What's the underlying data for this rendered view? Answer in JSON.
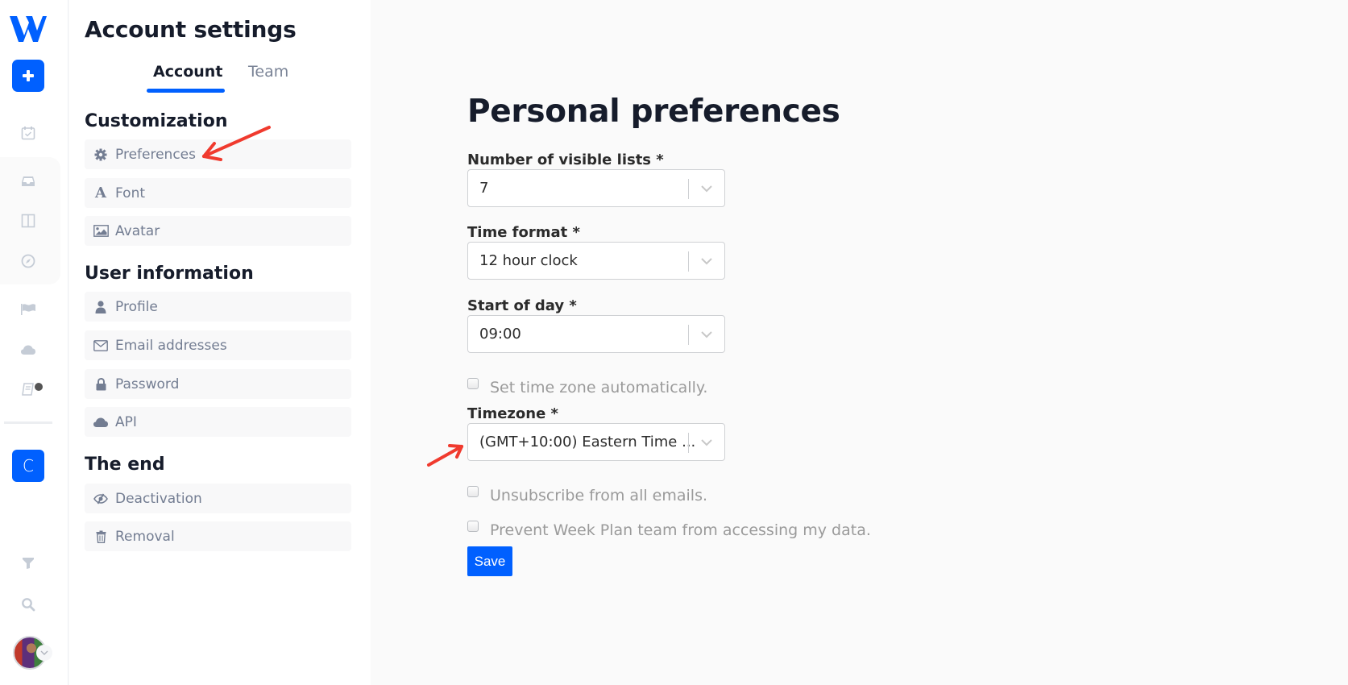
{
  "rail": {
    "logo": "W",
    "add_button": "+",
    "icons": [
      "calendar-check-icon",
      "inbox-icon",
      "columns-icon",
      "compass-icon",
      "flag-icon",
      "cloud-icon",
      "book-icon"
    ],
    "workspace_initial": "C"
  },
  "settings": {
    "title": "Account settings",
    "tabs": [
      {
        "label": "Account",
        "active": true
      },
      {
        "label": "Team",
        "active": false
      }
    ],
    "sections": [
      {
        "title": "Customization",
        "items": [
          {
            "label": "Preferences",
            "icon": "gear-icon"
          },
          {
            "label": "Font",
            "icon": "font-icon"
          },
          {
            "label": "Avatar",
            "icon": "image-icon"
          }
        ]
      },
      {
        "title": "User information",
        "items": [
          {
            "label": "Profile",
            "icon": "user-icon"
          },
          {
            "label": "Email addresses",
            "icon": "envelope-icon"
          },
          {
            "label": "Password",
            "icon": "lock-icon"
          },
          {
            "label": "API",
            "icon": "cloud-icon"
          }
        ]
      },
      {
        "title": "The end",
        "items": [
          {
            "label": "Deactivation",
            "icon": "eye-slash-icon"
          },
          {
            "label": "Removal",
            "icon": "trash-icon"
          }
        ]
      }
    ]
  },
  "main": {
    "title": "Personal preferences",
    "fields": {
      "visible_lists": {
        "label": "Number of visible lists *",
        "value": "7"
      },
      "time_format": {
        "label": "Time format *",
        "value": "12 hour clock"
      },
      "start_of_day": {
        "label": "Start of day *",
        "value": "09:00"
      },
      "timezone": {
        "label": "Timezone *",
        "value": "(GMT+10:00) Eastern Time ..."
      }
    },
    "checkboxes": {
      "auto_timezone": {
        "label": "Set time zone automatically.",
        "checked": false
      },
      "unsubscribe": {
        "label": "Unsubscribe from all emails.",
        "checked": false
      },
      "prevent_access": {
        "label": "Prevent Week Plan team from accessing my data.",
        "checked": false
      }
    },
    "save_label": "Save"
  },
  "colors": {
    "accent": "#0060ff",
    "annotation": "#f03a2e"
  }
}
